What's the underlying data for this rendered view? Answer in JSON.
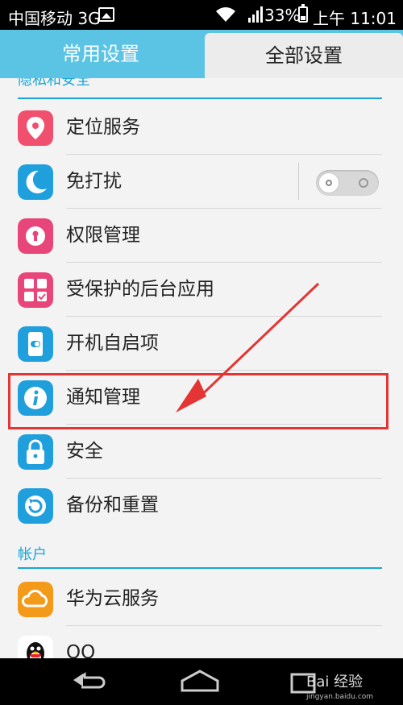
{
  "status_bar": {
    "carrier": "中国移动 3G",
    "network_badge": "3G\nG",
    "battery": "33%",
    "time": "上午 11:01"
  },
  "tabs": [
    {
      "label": "常用设置",
      "active": false
    },
    {
      "label": "全部设置",
      "active": true
    }
  ],
  "sections": {
    "privacy": "隐私和安全",
    "account": "帐户"
  },
  "items": [
    {
      "label": "定位服务",
      "icon": "location-icon",
      "color": "#f0506e"
    },
    {
      "label": "免打扰",
      "icon": "moon-icon",
      "color": "#1f9fdc",
      "toggle": "off"
    },
    {
      "label": "权限管理",
      "icon": "lock-keyhole-icon",
      "color": "#e8467a"
    },
    {
      "label": "受保护的后台应用",
      "icon": "protected-apps-icon",
      "color": "#e8467a"
    },
    {
      "label": "开机自启项",
      "icon": "startup-icon",
      "color": "#1f9fdc"
    },
    {
      "label": "通知管理",
      "icon": "info-icon",
      "color": "#1f9fdc"
    },
    {
      "label": "安全",
      "icon": "padlock-icon",
      "color": "#1f9fdc"
    },
    {
      "label": "备份和重置",
      "icon": "backup-icon",
      "color": "#1f9fdc"
    },
    {
      "label": "华为云服务",
      "icon": "cloud-icon",
      "color": "#f39a1a"
    },
    {
      "label": "QQ",
      "icon": "qq-penguin-icon",
      "color": "#ffffff"
    }
  ],
  "annotation": {
    "highlight_color": "#e43434"
  },
  "watermark": {
    "text": "Bai 经验",
    "subtext": "jingyan.baidu.com"
  },
  "colors": {
    "accent": "#5bc3e4",
    "section_text": "#1aa6d7"
  }
}
